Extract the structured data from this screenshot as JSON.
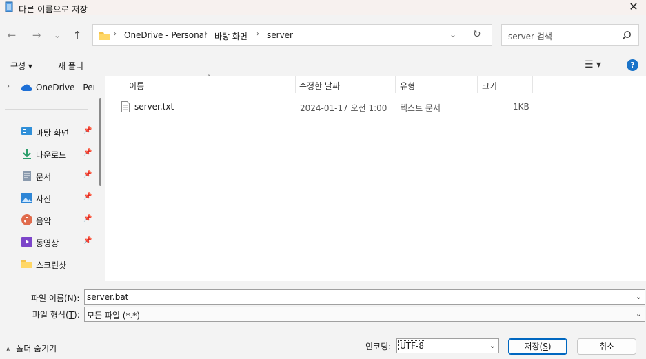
{
  "window": {
    "title": "다른 이름으로 저장",
    "close_glyph": "✕"
  },
  "nav": {
    "back": "←",
    "forward": "→",
    "recent": "⌄",
    "up": "↑"
  },
  "breadcrumb": [
    "OneDrive - Personal",
    "바탕 화면",
    "server"
  ],
  "search": {
    "placeholder": "server 검색"
  },
  "toolbar": {
    "organize": "구성 ▾",
    "new_folder": "새 폴더",
    "view": "☰ ▾",
    "help": "?"
  },
  "sidebar": {
    "onedrive": "OneDrive - Personal",
    "items": [
      {
        "label": "바탕 화면",
        "icon": "desktop-icon"
      },
      {
        "label": "다운로드",
        "icon": "download-icon"
      },
      {
        "label": "문서",
        "icon": "document-icon"
      },
      {
        "label": "사진",
        "icon": "pictures-icon"
      },
      {
        "label": "음악",
        "icon": "music-icon"
      },
      {
        "label": "동영상",
        "icon": "video-icon"
      },
      {
        "label": "스크린샷",
        "icon": "folder-icon"
      }
    ]
  },
  "columns": {
    "name": "이름",
    "modified": "수정한 날짜",
    "type": "유형",
    "size": "크기"
  },
  "files": [
    {
      "name": "server.txt",
      "modified": "2024-01-17 오전 1:00",
      "type": "텍스트 문서",
      "size": "1KB"
    }
  ],
  "form": {
    "filename_label": "파일 이름",
    "filename_key": "N",
    "filename_value": "server.bat",
    "filetype_label": "파일 형식",
    "filetype_key": "T",
    "filetype_value": "모든 파일  (*.*)",
    "hide_folders": "폴더 숨기기",
    "encoding_label": "인코딩:",
    "encoding_value": "UTF-8",
    "save_label": "저장",
    "save_key": "S",
    "cancel_label": "취소"
  },
  "colors": {
    "accent": "#0067c0",
    "help": "#1b74c9"
  }
}
